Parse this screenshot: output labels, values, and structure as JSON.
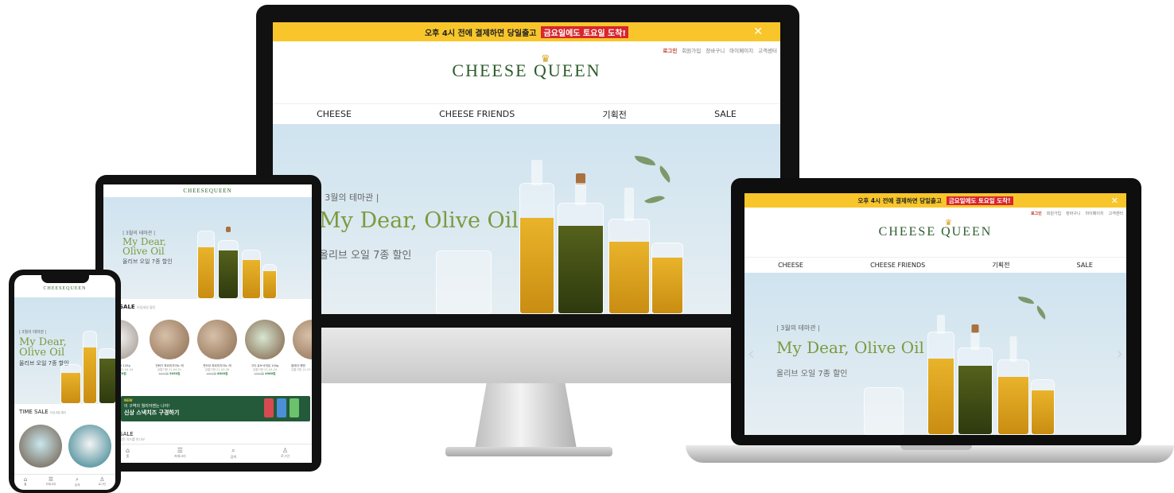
{
  "brand": {
    "logo_prefix": "CHEESE",
    "logo_suffix": "QUEEN"
  },
  "topbar": {
    "text": "오후 4시 전에 결제하면 당일출고",
    "highlight": "금요일에도 토요일 도착!",
    "close_glyph": "✕"
  },
  "util_links": [
    "로그인",
    "회원가입",
    "장바구니",
    "마이페이지",
    "고객센터"
  ],
  "nav": [
    "CHEESE",
    "CHEESE FRIENDS",
    "기획전",
    "SALE"
  ],
  "hero": {
    "kicker": "| 3월의 테마관 |",
    "title": "My Dear, Olive Oil",
    "title_line1": "My Dear,",
    "title_line2": "Olive Oil",
    "subtitle": "올리브 오일 7종 할인"
  },
  "time_sale": {
    "label": "TIME SALE",
    "note": "타임세일 할인"
  },
  "tablet": {
    "sale_label": "SALE",
    "sale_note": "타임세일 할인",
    "products": [
      {
        "name": "브리치즈 125g",
        "date": "유통기한 21.04.24",
        "old": "",
        "price": "5270원"
      },
      {
        "name": "전화기 파르미지아노 레",
        "date": "유통기한 21.04.01",
        "old": "6000원",
        "price": "5050원"
      },
      {
        "name": "판타코 파르미지아노 레",
        "date": "유통기한 21.03.28",
        "old": "9000원",
        "price": "8000원"
      },
      {
        "name": "고다 큐브 6개입 100g",
        "date": "유통기한 21.03.24",
        "old": "5500원",
        "price": "4960원"
      },
      {
        "name": "발레아 에멘",
        "date": "유통기한 21.03",
        "old": "",
        "price": ""
      }
    ],
    "banner_new": "NEW",
    "banner_line1": "이 구역의 월리어멘는 나야!",
    "banner_line2": "신상 스낵치즈 구경하기",
    "section2_title": "SALE",
    "section2_note": "할인 치즈를 만나보",
    "tabbar": [
      "홈",
      "카테고리",
      "검색",
      "로그인"
    ]
  },
  "phone": {
    "tabbar": [
      "홈",
      "카테고리",
      "검색",
      "로그인"
    ]
  }
}
